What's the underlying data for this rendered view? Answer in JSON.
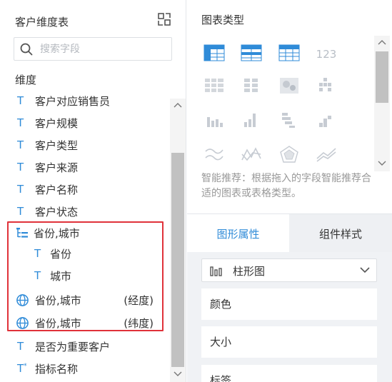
{
  "left_panel": {
    "title": "客户维度表",
    "search": {
      "placeholder": "搜索字段"
    },
    "dimension_label": "维度",
    "fields": [
      {
        "type": "text",
        "label": "客户对应销售员"
      },
      {
        "type": "text",
        "label": "客户规模"
      },
      {
        "type": "text",
        "label": "客户类型"
      },
      {
        "type": "text",
        "label": "客户来源"
      },
      {
        "type": "text",
        "label": "客户名称"
      },
      {
        "type": "text",
        "label": "客户状态"
      },
      {
        "type": "tree",
        "label": "省份,城市"
      },
      {
        "type": "text-sub",
        "label": "省份"
      },
      {
        "type": "text-sub",
        "label": "城市"
      },
      {
        "type": "geo",
        "label": "省份,城市",
        "suffix": "(经度)"
      },
      {
        "type": "geo",
        "label": "省份,城市",
        "suffix": "(纬度)"
      },
      {
        "type": "text",
        "label": "是否为重要客户"
      },
      {
        "type": "text-star",
        "label": "指标名称"
      }
    ],
    "text_type_glyph": "T"
  },
  "right_panel": {
    "chart_type_title": "图表类型",
    "chart_types": [
      {
        "icon": "table-icon",
        "active": true
      },
      {
        "icon": "crosstab-icon",
        "active": true
      },
      {
        "icon": "detail-table-icon",
        "active": true
      },
      {
        "icon": "kpi-number-icon",
        "text": "123",
        "active": false
      },
      {
        "icon": "grid-table-icon",
        "active": false
      },
      {
        "icon": "dot-matrix-icon",
        "active": false
      },
      {
        "icon": "heatmap-icon",
        "active": false
      },
      {
        "icon": "scatter-block-icon",
        "active": false
      },
      {
        "icon": "bar-chart-icon",
        "active": false
      },
      {
        "icon": "bar-line-icon",
        "active": false
      },
      {
        "icon": "stacked-bar-icon",
        "active": false
      },
      {
        "icon": "step-bar-icon",
        "active": false
      },
      {
        "icon": "wave-line-icon",
        "active": false
      },
      {
        "icon": "zigzag-line-icon",
        "active": false
      },
      {
        "icon": "radar-icon",
        "active": false
      },
      {
        "icon": "area-line-icon",
        "active": false
      }
    ],
    "recommend_text": "智能推荐：根据拖入的字段智能推荐合适的图表或表格类型。",
    "tabs": [
      {
        "label": "图形属性",
        "active": true
      },
      {
        "label": "组件样式",
        "active": false
      }
    ],
    "chart_select": {
      "value": "柱形图"
    },
    "properties": [
      "颜色",
      "大小",
      "标签"
    ]
  },
  "colors": {
    "accent": "#2f8bd8",
    "highlight_border": "#e0323a",
    "muted_icon": "#c7ccd3"
  }
}
